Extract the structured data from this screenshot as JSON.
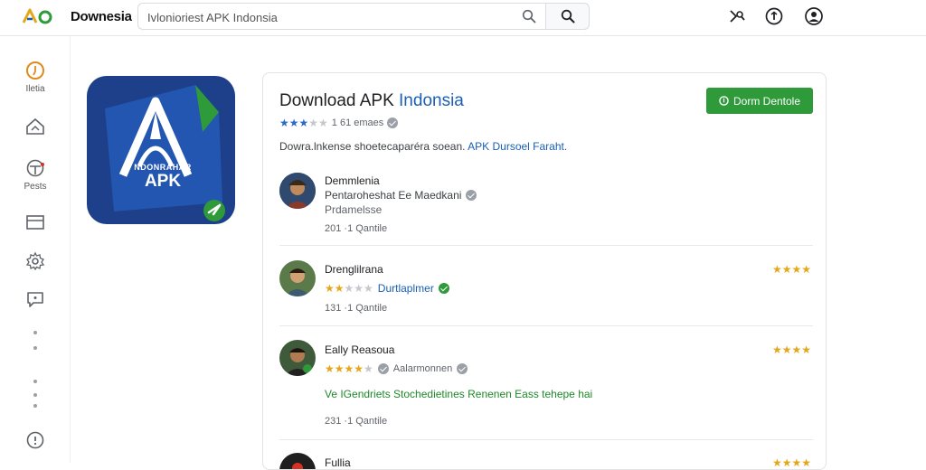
{
  "header": {
    "brand": "Downesia",
    "search_value": "Ivlonioriest APK Indonsia",
    "search_placeholder": "Search",
    "icons": [
      "logo-icon",
      "search-icon",
      "share-icon",
      "info-icon",
      "account-icon"
    ]
  },
  "rail": {
    "items": [
      {
        "label": "Iletia",
        "icon": "home-icon"
      },
      {
        "label": "",
        "icon": "apps-icon"
      },
      {
        "label": "Pests",
        "icon": "games-icon"
      },
      {
        "label": "",
        "icon": "window-icon"
      },
      {
        "label": "",
        "icon": "settings-icon"
      },
      {
        "label": "",
        "icon": "chat-icon"
      },
      {
        "label": "",
        "icon": "help-icon"
      }
    ]
  },
  "app": {
    "icon_text": "APK",
    "icon_subtext": "NDONRAHAR",
    "title_main": "Download APK ",
    "title_accent": "Indonsia",
    "rating_count": "1  61  emaes",
    "stars_on": 3,
    "description_main": "Dowra.lnkense shoetecaparéra soean. ",
    "description_link": "APK  Dursoel Faraht.",
    "download_label": "Dorm Dentole",
    "colors": {
      "accent": "#1a5fb4",
      "download": "#2e9a3a",
      "star": "#e3a71a",
      "icon_bg": "#1e3f8a"
    }
  },
  "reviews": [
    {
      "name": "Demmlenia",
      "line1": "Pentaroheshat Ee Maedkani",
      "line2": "Prdamelsse",
      "meta": "201  ·1  Qantile",
      "right_stars": ""
    },
    {
      "name": "Drenglilrana",
      "line1": "Durtlaplmer",
      "meta": "131  ·1  Qantile",
      "right_stars": "★★★★"
    },
    {
      "name": "Eally Reasoua",
      "line1": "Aalarmonnen",
      "body": "Ve IGendriets  Stochedietines  Renenen Eass tehepe hai",
      "meta": "231  ·1  Qantile",
      "right_stars": "★★★★"
    },
    {
      "name": "Fullia",
      "right_stars": "★★★★"
    }
  ]
}
